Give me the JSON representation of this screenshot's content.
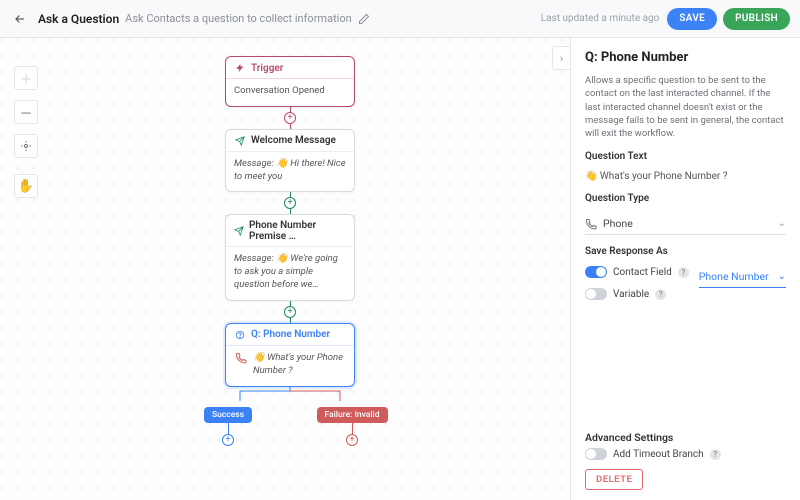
{
  "header": {
    "title": "Ask a Question",
    "subtitle": "Ask Contacts a question to collect information",
    "last_updated": "Last updated a minute ago",
    "save": "SAVE",
    "publish": "PUBLISH"
  },
  "flow": {
    "trigger": {
      "title": "Trigger",
      "body": "Conversation Opened"
    },
    "welcome": {
      "title": "Welcome Message",
      "prefix": "Message:",
      "body": "👋 Hi there! Nice to meet you"
    },
    "premise": {
      "title": "Phone Number Premise …",
      "prefix": "Message:",
      "body": "👋 We're going to ask you a simple question before we…"
    },
    "question": {
      "title": "Q: Phone Number",
      "body": "👋 What's your Phone Number ?"
    },
    "branches": {
      "success": "Success",
      "failure": "Failure: Invalid"
    }
  },
  "panel": {
    "title": "Q: Phone Number",
    "desc": "Allows a specific question to be sent to the contact on the last interacted channel. If the last interacted channel doesn't exist or the message fails to be sent in general, the contact will exit the workflow.",
    "question_text_label": "Question Text",
    "question_text_value": "👋 What's your Phone Number ?",
    "question_type_label": "Question Type",
    "question_type_value": "Phone",
    "save_response_label": "Save Response As",
    "contact_field_label": "Contact Field",
    "contact_field_value": "Phone Number",
    "variable_label": "Variable",
    "advanced_label": "Advanced Settings",
    "timeout_label": "Add Timeout Branch",
    "delete": "DELETE"
  }
}
